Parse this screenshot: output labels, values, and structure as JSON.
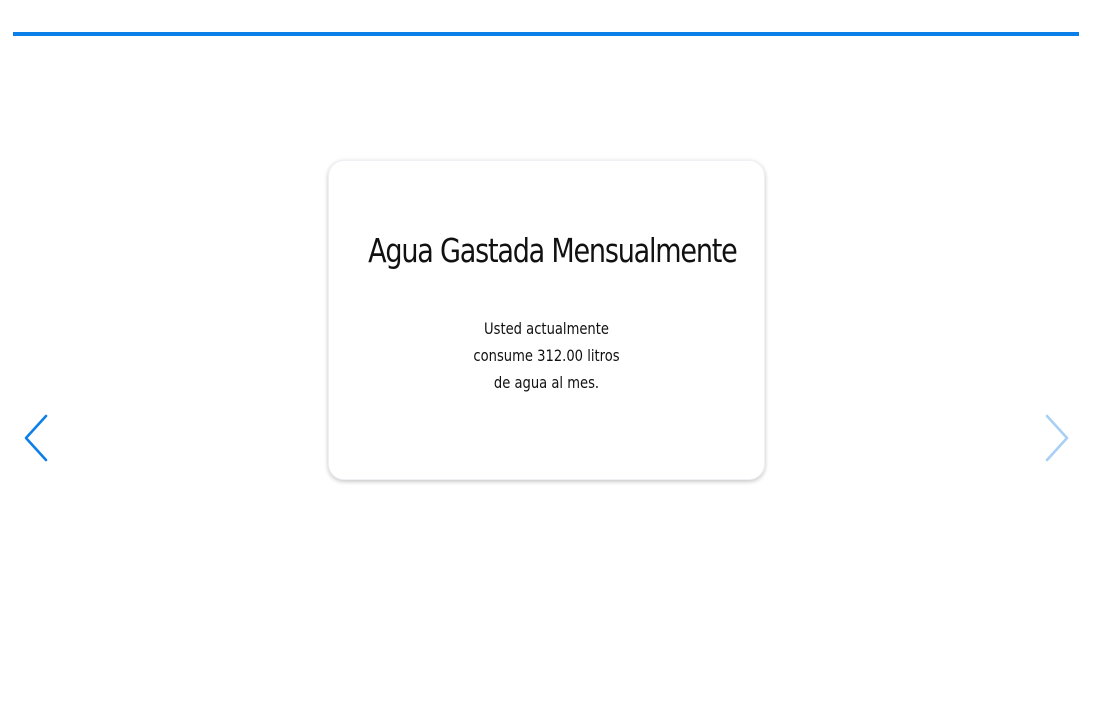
{
  "card": {
    "title": "Agua Gastada Mensualmente",
    "lines": [
      "Usted actualmente",
      "consume 312.00 litros",
      "de agua al mes."
    ]
  },
  "navigation": {
    "prev_icon": "chevron-left-icon",
    "next_icon": "chevron-right-icon"
  },
  "colors": {
    "accent": "#0d7fe8",
    "accent_disabled": "#a9cff5",
    "text": "#111111"
  }
}
